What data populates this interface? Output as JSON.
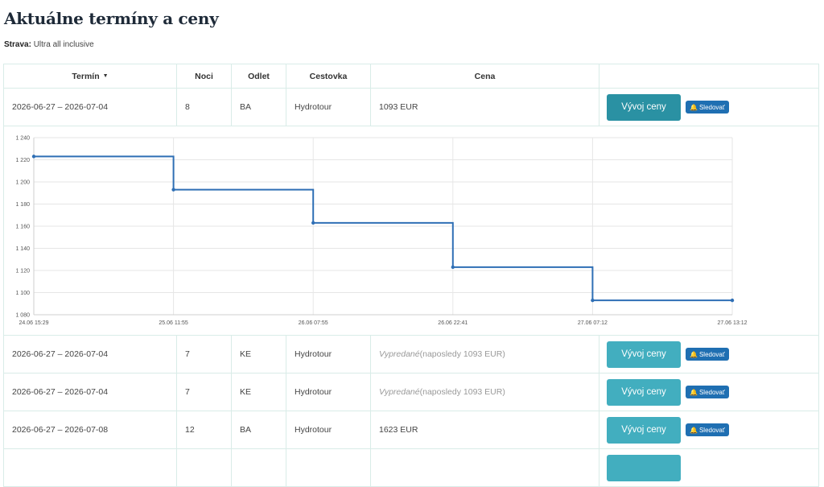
{
  "page": {
    "title": "Aktuálne termíny a ceny",
    "board_label": "Strava:",
    "board_value": "Ultra all inclusive"
  },
  "table": {
    "headers": {
      "term": "Termín",
      "sort_arrow": "▼",
      "nights": "Noci",
      "departure": "Odlet",
      "agency": "Cestovka",
      "price": "Cena"
    },
    "rows": [
      {
        "term": "2026-06-27 – 2026-07-04",
        "nights": "8",
        "departure": "BA",
        "agency": "Hydrotour",
        "price": "1093 EUR",
        "sold_label": "",
        "sold_rest": "",
        "chart_button": "Vývoj ceny",
        "watch_button": "Sledovať"
      },
      {
        "term": "2026-06-27 – 2026-07-04",
        "nights": "7",
        "departure": "KE",
        "agency": "Hydrotour",
        "price": "",
        "sold_label": "Vypredané",
        "sold_rest": " (naposledy 1093 EUR)",
        "chart_button": "Vývoj ceny",
        "watch_button": "Sledovať"
      },
      {
        "term": "2026-06-27 – 2026-07-04",
        "nights": "7",
        "departure": "KE",
        "agency": "Hydrotour",
        "price": "",
        "sold_label": "Vypredané",
        "sold_rest": " (naposledy 1093 EUR)",
        "chart_button": "Vývoj ceny",
        "watch_button": "Sledovať"
      },
      {
        "term": "2026-06-27 – 2026-07-08",
        "nights": "12",
        "departure": "BA",
        "agency": "Hydrotour",
        "price": "1623 EUR",
        "sold_label": "",
        "sold_rest": "",
        "chart_button": "Vývoj ceny",
        "watch_button": "Sledovať"
      }
    ]
  },
  "icons": {
    "watch": "bell-icon",
    "sort": "sort-down-icon"
  },
  "colors": {
    "line": "#2f6fb5",
    "button": "#42aebf",
    "button_active": "#2a91a3",
    "watch": "#1f6fb2"
  },
  "chart_data": {
    "type": "line",
    "step": true,
    "x": [
      "24.06 15:29",
      "25.06 11:55",
      "26.06 07:55",
      "26.06 22:41",
      "27.06 07:12",
      "27.06 13:12"
    ],
    "y": [
      1223,
      1193,
      1163,
      1123,
      1093,
      1093
    ],
    "ylim": [
      1080,
      1240
    ],
    "yticks": [
      1080,
      1100,
      1120,
      1140,
      1160,
      1180,
      1200,
      1220,
      1240
    ],
    "ytick_labels": [
      "1 080",
      "1 100",
      "1 120",
      "1 140",
      "1 160",
      "1 180",
      "1 200",
      "1 220",
      "1 240"
    ],
    "grid": true
  }
}
